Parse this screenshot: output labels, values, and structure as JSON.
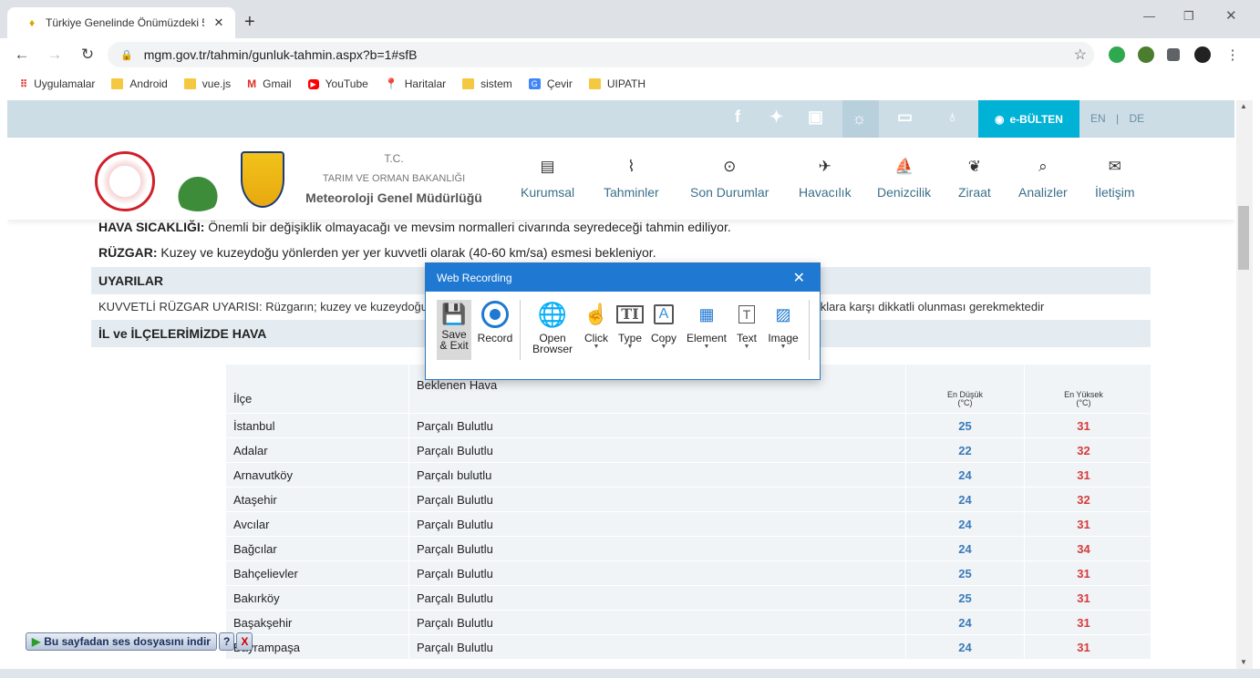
{
  "browser": {
    "tab_title": "Türkiye Genelinde Önümüzdeki 5",
    "url": "mgm.gov.tr/tahmin/gunluk-tahmin.aspx?b=1#sfB",
    "bookmarks": [
      "Uygulamalar",
      "Android",
      "vue.js",
      "Gmail",
      "YouTube",
      "Haritalar",
      "sistem",
      "Çevir",
      "UIPATH"
    ]
  },
  "site": {
    "ebulten": "e-BÜLTEN",
    "lang_en": "EN",
    "lang_sep": "|",
    "lang_de": "DE",
    "org_tc": "T.C.",
    "org_ministry": "TARIM VE ORMAN BAKANLIĞI",
    "org_name": "Meteoroloji Genel Müdürlüğü",
    "nav": [
      "Kurumsal",
      "Tahminler",
      "Son Durumlar",
      "Havacılık",
      "Denizcilik",
      "Ziraat",
      "Analizler",
      "İletişim"
    ]
  },
  "content": {
    "temp_label": "HAVA SICAKLIĞI:",
    "temp_text": " Önemli bir değişiklik olmayacağı ve mevsim normalleri civarında seyredeceği tahmin ediliyor.",
    "wind_label": "RÜZGAR:",
    "wind_text": " Kuzey ve kuzeydoğu yönlerden yer yer kuvvetli olarak (40-60 km/sa) esmesi bekleniyor.",
    "warnings_title": "UYARILAR",
    "warning_text": "KUVVETLİ RÜZGAR UYARISI: Rüzgarın; kuzey ve kuzeydoğu yönlerden kuvvetli olarak esmesi beklendiğinden yaşanabilecek olumsuzluklara karşı dikkatli olunması gerekmektedir",
    "district_title": "İL ve İLÇELERİMİZDE HAVA"
  },
  "table": {
    "headers": {
      "district": "İlçe",
      "weather": "Beklenen Hava",
      "min": "En Düşük",
      "min_unit": "(°C)",
      "max": "En Yüksek",
      "max_unit": "(°C)"
    },
    "rows": [
      {
        "district": "İstanbul",
        "weather": "Parçalı Bulutlu",
        "min": "25",
        "max": "31"
      },
      {
        "district": "Adalar",
        "weather": "Parçalı Bulutlu",
        "min": "22",
        "max": "32"
      },
      {
        "district": "Arnavutköy",
        "weather": "Parçalı bulutlu",
        "min": "24",
        "max": "31"
      },
      {
        "district": "Ataşehir",
        "weather": "Parçalı Bulutlu",
        "min": "24",
        "max": "32"
      },
      {
        "district": "Avcılar",
        "weather": "Parçalı Bulutlu",
        "min": "24",
        "max": "31"
      },
      {
        "district": "Bağcılar",
        "weather": "Parçalı Bulutlu",
        "min": "24",
        "max": "34"
      },
      {
        "district": "Bahçelievler",
        "weather": "Parçalı Bulutlu",
        "min": "25",
        "max": "31"
      },
      {
        "district": "Bakırköy",
        "weather": "Parçalı Bulutlu",
        "min": "25",
        "max": "31"
      },
      {
        "district": "Başakşehir",
        "weather": "Parçalı Bulutlu",
        "min": "24",
        "max": "31"
      },
      {
        "district": "Bayrampaşa",
        "weather": "Parçalı Bulutlu",
        "min": "24",
        "max": "31"
      }
    ]
  },
  "recorder": {
    "title": "Web Recording",
    "tools": [
      "Save & Exit",
      "Record",
      "Open Browser",
      "Click",
      "Type",
      "Copy",
      "Element",
      "Text",
      "Image"
    ]
  },
  "audio_label": "Bu sayfadan ses dosyasını indir"
}
